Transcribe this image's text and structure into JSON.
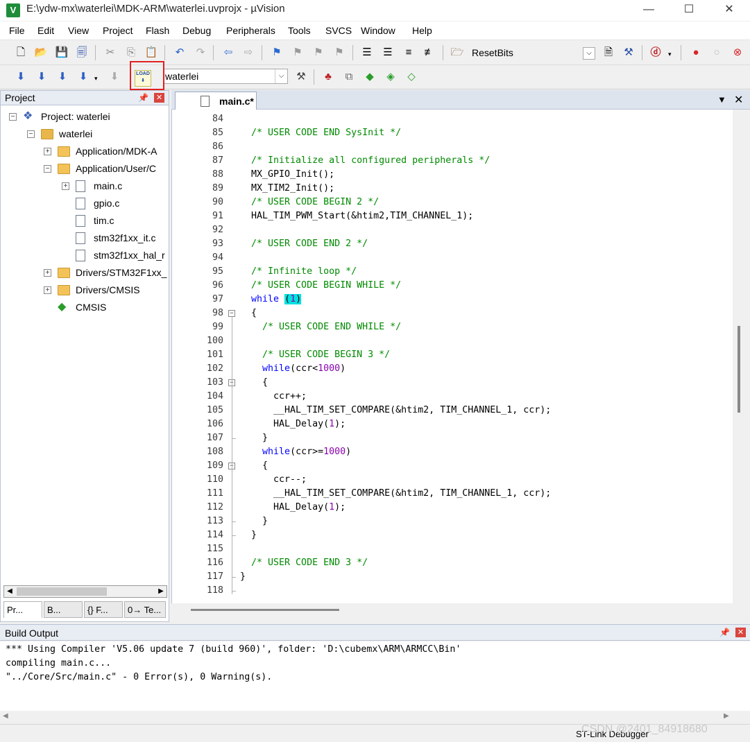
{
  "window": {
    "title": "E:\\ydw-mx\\waterlei\\MDK-ARM\\waterlei.uvprojx - µVision",
    "app_icon": "V",
    "minimize": "—",
    "maximize": "☐",
    "close": "✕"
  },
  "menu": [
    "File",
    "Edit",
    "View",
    "Project",
    "Flash",
    "Debug",
    "Peripherals",
    "Tools",
    "SVCS",
    "Window",
    "Help"
  ],
  "toolbar": {
    "resetbits_label": "ResetBits",
    "target_name": "waterlei",
    "load_icon_text": "LOAD",
    "colors": {
      "highlight_box": "#e02020"
    }
  },
  "project_panel": {
    "title": "Project",
    "tree": [
      {
        "label": "Project: waterlei",
        "icon": "project-icon",
        "expander": "−"
      },
      {
        "label": "waterlei",
        "icon": "target-icon",
        "expander": "−"
      },
      {
        "label": "Application/MDK-A",
        "icon": "folder-icon",
        "expander": "+"
      },
      {
        "label": "Application/User/C",
        "icon": "folder-icon",
        "expander": "−"
      },
      {
        "label": "main.c",
        "icon": "file-icon",
        "expander": "+"
      },
      {
        "label": "gpio.c",
        "icon": "file-icon",
        "expander": ""
      },
      {
        "label": "tim.c",
        "icon": "file-icon",
        "expander": ""
      },
      {
        "label": "stm32f1xx_it.c",
        "icon": "file-icon",
        "expander": ""
      },
      {
        "label": "stm32f1xx_hal_r",
        "icon": "file-icon",
        "expander": ""
      },
      {
        "label": "Drivers/STM32F1xx_",
        "icon": "folder-icon",
        "expander": "+"
      },
      {
        "label": "Drivers/CMSIS",
        "icon": "folder-icon",
        "expander": "+"
      },
      {
        "label": "CMSIS",
        "icon": "cmsis-icon",
        "expander": ""
      }
    ],
    "tabs": [
      "Pr...",
      "B...",
      "{} F...",
      "0→ Te..."
    ]
  },
  "editor": {
    "tab_label": "main.c*",
    "lines": [
      {
        "n": "84",
        "fold": "",
        "tokens": []
      },
      {
        "n": "85",
        "fold": "",
        "tokens": [
          {
            "t": "  /* USER CODE END SysInit */",
            "c": "comment"
          }
        ]
      },
      {
        "n": "86",
        "fold": "",
        "tokens": []
      },
      {
        "n": "87",
        "fold": "",
        "tokens": [
          {
            "t": "  /* Initialize all configured peripherals */",
            "c": "comment"
          }
        ]
      },
      {
        "n": "88",
        "fold": "",
        "tokens": [
          {
            "t": "  MX_GPIO_Init();",
            "c": "plain"
          }
        ]
      },
      {
        "n": "89",
        "fold": "",
        "tokens": [
          {
            "t": "  MX_TIM2_Init();",
            "c": "plain"
          }
        ]
      },
      {
        "n": "90",
        "fold": "",
        "tokens": [
          {
            "t": "  /* USER CODE BEGIN 2 */",
            "c": "comment"
          }
        ]
      },
      {
        "n": "91",
        "fold": "",
        "tokens": [
          {
            "t": "  HAL_TIM_PWM_Start(&htim2,TIM_CHANNEL_1);",
            "c": "plain"
          }
        ]
      },
      {
        "n": "92",
        "fold": "",
        "tokens": []
      },
      {
        "n": "93",
        "fold": "",
        "tokens": [
          {
            "t": "  /* USER CODE END 2 */",
            "c": "comment"
          }
        ]
      },
      {
        "n": "94",
        "fold": "",
        "tokens": []
      },
      {
        "n": "95",
        "fold": "",
        "tokens": [
          {
            "t": "  /* Infinite loop */",
            "c": "comment"
          }
        ]
      },
      {
        "n": "96",
        "fold": "",
        "tokens": [
          {
            "t": "  /* USER CODE BEGIN WHILE */",
            "c": "comment"
          }
        ]
      },
      {
        "n": "97",
        "fold": "",
        "tokens": [
          {
            "t": "  ",
            "c": "plain"
          },
          {
            "t": "while",
            "c": "kw"
          },
          {
            "t": " ",
            "c": "plain"
          },
          {
            "t": "(",
            "c": "hl"
          },
          {
            "t": "1",
            "c": "num-hl"
          },
          {
            "t": ")",
            "c": "hl"
          }
        ]
      },
      {
        "n": "98",
        "fold": "open",
        "tokens": [
          {
            "t": "  {",
            "c": "plain"
          }
        ]
      },
      {
        "n": "99",
        "fold": "",
        "tokens": [
          {
            "t": "    /* USER CODE END WHILE */",
            "c": "comment"
          }
        ]
      },
      {
        "n": "100",
        "fold": "",
        "tokens": []
      },
      {
        "n": "101",
        "fold": "",
        "tokens": [
          {
            "t": "    /* USER CODE BEGIN 3 */",
            "c": "comment"
          }
        ]
      },
      {
        "n": "102",
        "fold": "",
        "tokens": [
          {
            "t": "    ",
            "c": "plain"
          },
          {
            "t": "while",
            "c": "kw"
          },
          {
            "t": "(ccr<",
            "c": "plain"
          },
          {
            "t": "1000",
            "c": "num"
          },
          {
            "t": ")",
            "c": "plain"
          }
        ]
      },
      {
        "n": "103",
        "fold": "open",
        "tokens": [
          {
            "t": "    {",
            "c": "plain"
          }
        ]
      },
      {
        "n": "104",
        "fold": "",
        "tokens": [
          {
            "t": "      ccr++;",
            "c": "plain"
          }
        ]
      },
      {
        "n": "105",
        "fold": "",
        "tokens": [
          {
            "t": "      __HAL_TIM_SET_COMPARE(&htim2, TIM_CHANNEL_1, ccr);",
            "c": "plain"
          }
        ]
      },
      {
        "n": "106",
        "fold": "",
        "tokens": [
          {
            "t": "      HAL_Delay(",
            "c": "plain"
          },
          {
            "t": "1",
            "c": "num"
          },
          {
            "t": ");",
            "c": "plain"
          }
        ]
      },
      {
        "n": "107",
        "fold": "end",
        "tokens": [
          {
            "t": "    }",
            "c": "plain"
          }
        ]
      },
      {
        "n": "108",
        "fold": "",
        "tokens": [
          {
            "t": "    ",
            "c": "plain"
          },
          {
            "t": "while",
            "c": "kw"
          },
          {
            "t": "(ccr>=",
            "c": "plain"
          },
          {
            "t": "1000",
            "c": "num"
          },
          {
            "t": ")",
            "c": "plain"
          }
        ]
      },
      {
        "n": "109",
        "fold": "open",
        "tokens": [
          {
            "t": "    {",
            "c": "plain"
          }
        ]
      },
      {
        "n": "110",
        "fold": "",
        "tokens": [
          {
            "t": "      ccr--;",
            "c": "plain"
          }
        ]
      },
      {
        "n": "111",
        "fold": "",
        "tokens": [
          {
            "t": "      __HAL_TIM_SET_COMPARE(&htim2, TIM_CHANNEL_1, ccr);",
            "c": "plain"
          }
        ]
      },
      {
        "n": "112",
        "fold": "",
        "tokens": [
          {
            "t": "      HAL_Delay(",
            "c": "plain"
          },
          {
            "t": "1",
            "c": "num"
          },
          {
            "t": ");",
            "c": "plain"
          }
        ]
      },
      {
        "n": "113",
        "fold": "end",
        "tokens": [
          {
            "t": "    }",
            "c": "plain"
          }
        ]
      },
      {
        "n": "114",
        "fold": "end",
        "tokens": [
          {
            "t": "  }",
            "c": "plain"
          }
        ]
      },
      {
        "n": "115",
        "fold": "",
        "tokens": []
      },
      {
        "n": "116",
        "fold": "",
        "tokens": [
          {
            "t": "  /* USER CODE END 3 */",
            "c": "comment"
          }
        ]
      },
      {
        "n": "117",
        "fold": "end",
        "tokens": [
          {
            "t": "}",
            "c": "plain"
          }
        ]
      },
      {
        "n": "118",
        "fold": "end",
        "tokens": []
      }
    ]
  },
  "build_output": {
    "title": "Build Output",
    "lines": [
      "*** Using Compiler 'V5.06 update 7 (build 960)', folder: 'D:\\cubemx\\ARM\\ARMCC\\Bin'",
      "compiling main.c...",
      "\"../Core/Src/main.c\" - 0 Error(s), 0 Warning(s)."
    ]
  },
  "status": {
    "debugger": "ST-Link Debugger",
    "watermark": "CSDN @2401_84918680"
  }
}
